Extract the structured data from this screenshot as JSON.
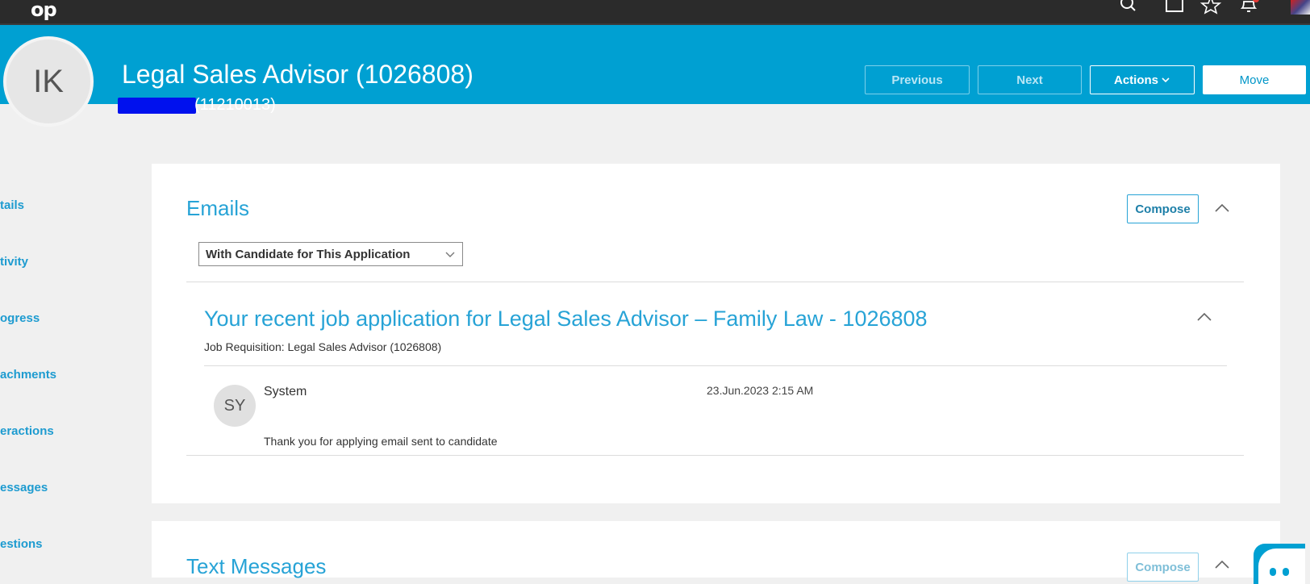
{
  "topbar": {
    "logo": "op",
    "icons": [
      "search-icon",
      "window-icon",
      "star-icon",
      "bell-icon",
      "avatar-icon"
    ]
  },
  "header": {
    "avatar_initials": "IK",
    "title": "Legal Sales Advisor (1026808)",
    "subtitle_id": "(11210013)",
    "buttons": {
      "previous": "Previous",
      "next": "Next",
      "actions": "Actions",
      "move": "Move"
    }
  },
  "sidebar": {
    "items": [
      "tails",
      "tivity",
      "ogress",
      "achments",
      "eractions",
      "essages",
      "estions"
    ]
  },
  "emails": {
    "title": "Emails",
    "compose": "Compose",
    "filter": "With Candidate for This Application",
    "message": {
      "subject": "Your recent job application for Legal Sales Advisor – Family Law - 1026808",
      "requisition": "Job Requisition: Legal Sales Advisor (1026808)",
      "sender_initials": "SY",
      "sender": "System",
      "date": "23.Jun.2023 2:15 AM",
      "body": "Thank you for applying email sent to candidate"
    }
  },
  "text_messages": {
    "title": "Text Messages",
    "compose": "Compose"
  },
  "colors": {
    "header": "#00a0d2",
    "accent": "#27a3d6",
    "background": "#f0f0f0"
  }
}
